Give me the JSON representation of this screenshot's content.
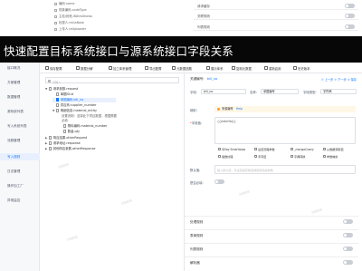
{
  "banner": {
    "title": "快速配置目标系统接口与源系统接口字段关系"
  },
  "bg_top": {
    "tree": [
      "编码.name",
      "现象编码.codeType",
      "主检/其他.ifAttrsShows",
      "检视人.reLiaBase",
      "上传人.reUploader"
    ],
    "settings": [
      "请求缓存",
      "关联规则",
      "列表规则"
    ]
  },
  "leftnav": {
    "items": [
      "接口概况",
      "方案管理",
      "数据管理",
      "源系统列表",
      "写入系统列表",
      "流程管理",
      "写入规则",
      "日志管理",
      "操作加工厂",
      "异常监控"
    ],
    "active_index": 6
  },
  "toolbar": {
    "buttons": [
      "保存配置",
      "数据分解",
      "加工体系管理",
      "导出配置",
      "元数据选题",
      "展示体系",
      "复制元数据",
      "重新启用",
      "历史版本"
    ]
  },
  "tree": {
    "search_placeholder": "请输入",
    "nodes": [
      {
        "label": "请求参数.request",
        "level": 0,
        "arrow": "▼",
        "selected": false
      },
      {
        "label": "单据ID.id",
        "level": 1,
        "arrow": "",
        "selected": false
      },
      {
        "label": "单据编码.bill_no",
        "level": 1,
        "arrow": "",
        "selected": true
      },
      {
        "label": "供应商.supplier_number",
        "level": 1,
        "arrow": "",
        "selected": false
      },
      {
        "label": "明细信息.material_entity",
        "level": 1,
        "arrow": "▼",
        "selected": false
      },
      {
        "label": "物料编码.material_number",
        "level": 2,
        "arrow": "",
        "selected": false
      },
      {
        "label": "数量.qty",
        "level": 2,
        "arrow": "",
        "selected": false
      },
      {
        "label": "响应结果.otherRequest",
        "level": 0,
        "arrow": "▶",
        "selected": false
      },
      {
        "label": "请求地址.response",
        "level": 0,
        "arrow": "▶",
        "selected": false
      },
      {
        "label": "其他响应参数.otherResponse",
        "level": 0,
        "arrow": "▶",
        "selected": false
      }
    ],
    "note": "设置说明：选择此下项目数据，根据需要",
    "note2": "必填",
    "watermark": "加载数据"
  },
  "form": {
    "header_label": "关键编号:",
    "header_link": "bill_no",
    "header_right": "① 上一步  ② 下一步  ③ 保存",
    "field_label": "字段:",
    "field_value": "bill_no",
    "name_label": "名称:",
    "name_value": "单据编号",
    "type_label": "字段类型:",
    "type_value": "字符串",
    "mapping_label": "映射:",
    "notice_text": "来源编号",
    "notice_help": "Help",
    "value_label": "字段值:",
    "code_value": "{{orderNo}}",
    "chips": [
      "QDay SmartAsas",
      "设置流程参数",
      "_mongoQuary",
      "从数据源取值",
      "函数处理",
      "手写值",
      "字典转换",
      "参数映射"
    ],
    "desc_label": "默认值:",
    "desc_placeholder": "输入默认值，可设置固定数值或使用动态参数",
    "sync_label": "是否必填:"
  },
  "sections": [
    "处理规则",
    "表单规则",
    "列表规则",
    "解析器"
  ]
}
